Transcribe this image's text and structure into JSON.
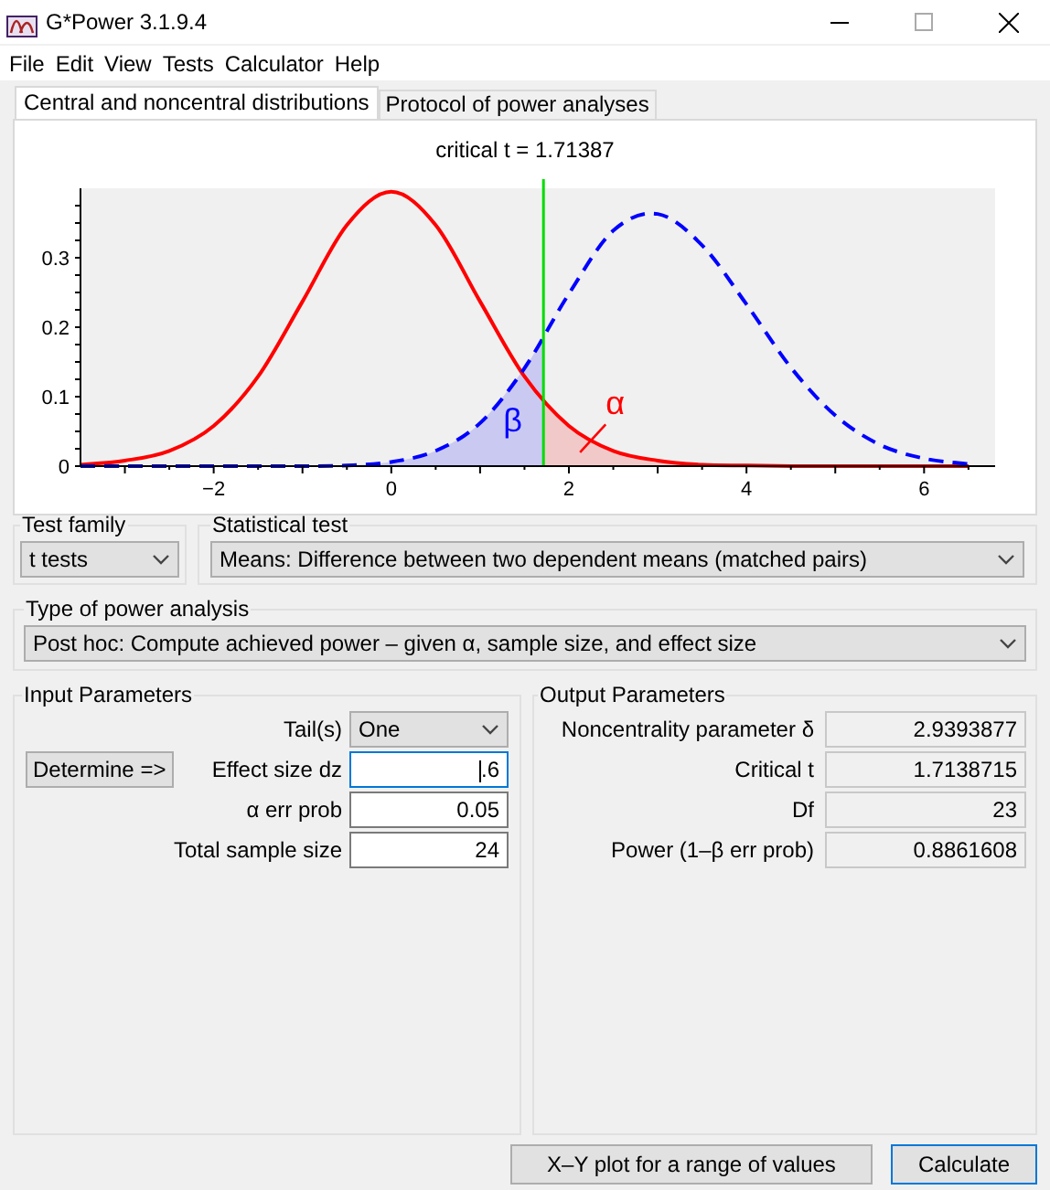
{
  "window": {
    "title": "G*Power 3.1.9.4"
  },
  "menu": [
    "File",
    "Edit",
    "View",
    "Tests",
    "Calculator",
    "Help"
  ],
  "tabs": [
    {
      "label": "Central and noncentral distributions",
      "selected": true
    },
    {
      "label": "Protocol of power analyses",
      "selected": false
    }
  ],
  "chart_data": {
    "type": "line",
    "title": "critical t = 1.71387",
    "x": [
      -3.5,
      -3,
      -2.5,
      -2,
      -1.5,
      -1,
      -0.5,
      0,
      0.5,
      1,
      1.5,
      2,
      2.5,
      3,
      3.5,
      4,
      4.5,
      5,
      5.5,
      6,
      6.5
    ],
    "xlim": [
      -3.5,
      6.8
    ],
    "ylim": [
      0,
      0.4
    ],
    "xticks": [
      -2,
      0,
      2,
      4,
      6
    ],
    "yticks": [
      0,
      0.1,
      0.2,
      0.3
    ],
    "series": [
      {
        "color": "#ff0000",
        "line_style": "solid",
        "values": [
          0.002,
          0.008,
          0.022,
          0.058,
          0.129,
          0.237,
          0.347,
          0.395,
          0.347,
          0.237,
          0.129,
          0.058,
          0.022,
          0.008,
          0.002,
          0.001,
          0,
          0,
          0,
          0,
          0
        ]
      },
      {
        "color": "#0000ff",
        "line_style": "dashed",
        "values": [
          0,
          0,
          0,
          0,
          0,
          0,
          0.001,
          0.006,
          0.022,
          0.062,
          0.141,
          0.248,
          0.339,
          0.363,
          0.318,
          0.233,
          0.142,
          0.073,
          0.031,
          0.011,
          0.003
        ]
      }
    ],
    "ref_lines": [
      {
        "axis": "x",
        "value": 1.71387,
        "color": "#00dd00"
      }
    ],
    "annotations": [
      "β",
      "α"
    ]
  },
  "test_family": {
    "label": "Test family",
    "value": "t tests"
  },
  "statistical_test": {
    "label": "Statistical test",
    "value": "Means: Difference between two dependent means (matched pairs)"
  },
  "power_analysis": {
    "label": "Type of power analysis",
    "value": "Post hoc: Compute achieved power – given α, sample size, and effect size"
  },
  "input_parameters": {
    "title": "Input Parameters",
    "determine_button": "Determine =>",
    "rows": [
      {
        "label": "Tail(s)",
        "kind": "select",
        "value": "One",
        "focused": false
      },
      {
        "label": "Effect size dz",
        "kind": "input",
        "value": ".6",
        "focused": true
      },
      {
        "label": "α err prob",
        "kind": "input",
        "value": "0.05",
        "focused": false
      },
      {
        "label": "Total sample size",
        "kind": "input",
        "value": "24",
        "focused": false
      }
    ]
  },
  "output_parameters": {
    "title": "Output Parameters",
    "rows": [
      {
        "label": "Noncentrality parameter δ",
        "value": "2.9393877"
      },
      {
        "label": "Critical t",
        "value": "1.7138715"
      },
      {
        "label": "Df",
        "value": "23"
      },
      {
        "label": "Power (1–β err prob)",
        "value": "0.8861608"
      }
    ]
  },
  "buttons": [
    {
      "label": "X–Y plot for a range of values",
      "default": false
    },
    {
      "label": "Calculate",
      "default": true
    }
  ]
}
